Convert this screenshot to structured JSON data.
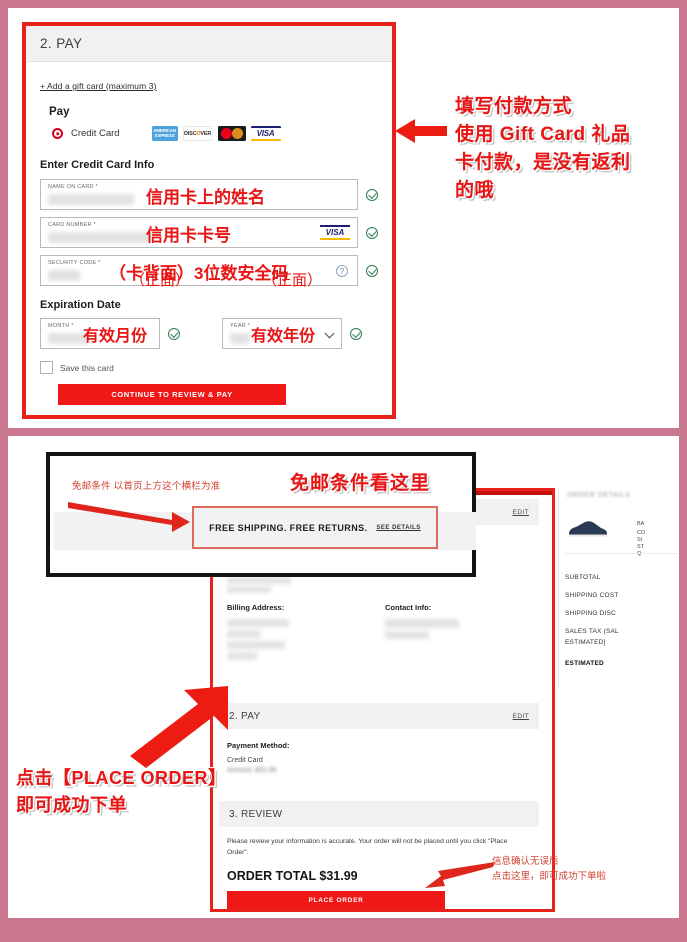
{
  "theme": {
    "outer_bg": "#c9788f",
    "accent_red": "#e8211b",
    "button_red": "#f01717",
    "annotation_red": "#e81515",
    "note_red": "#d0402f",
    "header_gray": "#f1f1f1"
  },
  "pay_card": {
    "header_title": "2. PAY",
    "gift_card_link": "+ Add a gift card (maximum 3)",
    "pay_label": "Pay",
    "method_label": "Credit Card",
    "card_logos": [
      {
        "name": "amex-logo",
        "text": "AMERICAN EXPRESS"
      },
      {
        "name": "discover-logo",
        "text": "DISCOVER"
      },
      {
        "name": "mastercard-logo",
        "text": ""
      },
      {
        "name": "visa-logo",
        "text": "VISA"
      }
    ],
    "enter_cc_title": "Enter Credit Card Info",
    "fields": [
      {
        "label": "NAME ON CARD *",
        "overlay": "信用卡上的姓名",
        "name": "name-on-card-field"
      },
      {
        "label": "CARD NUMBER *",
        "overlay": "信用卡卡号",
        "name": "card-number-field"
      },
      {
        "label": "SECURITY CODE *",
        "overlay": "（卡背面）3位数安全码",
        "name": "security-code-field"
      }
    ],
    "expiration_title": "Expiration Date",
    "month_label": "MONTH *",
    "year_label": "YEAR *",
    "month_overlay": "有效月份",
    "year_overlay": "有效年份",
    "month_side_note": "（正面）",
    "year_side_note": "（正面）",
    "save_card_label": "Save this card",
    "continue_button": "CONTINUE TO REVIEW & PAY",
    "visa_badge": "VISA",
    "help_icon": "?"
  },
  "annotation_top": {
    "lines": [
      "填写付款方式",
      "使用 Gift Card 礼品",
      "卡付款，是没有返利",
      "的哦"
    ],
    "arrow": "left-arrow-icon"
  },
  "shipping_callout": {
    "note": "免邮条件 以首页上方这个横栏为准",
    "highlight": "免邮条件看这里",
    "banner_text": "FREE SHIPPING. FREE RETURNS.",
    "see_details": "SEE DETAILS",
    "arrow": "right-arrow-icon"
  },
  "review_screen": {
    "ship_edit": "EDIT",
    "billing_address_label": "Billing Address:",
    "contact_info_label": "Contact Info:",
    "pay_section_title": "2. PAY",
    "pay_edit": "EDIT",
    "payment_method_label": "Payment Method:",
    "payment_method_value": "Credit Card",
    "payment_amount": "Amount: $31.99",
    "review_section_title": "3. REVIEW",
    "review_paragraph": "Please review your information is accurate. Your order will not be placed until you click \"Place Order\".",
    "order_total": "ORDER TOTAL $31.99",
    "place_order_button": "PLACE ORDER"
  },
  "order_details": {
    "header": "ORDER DETAILS",
    "item_icon": "sneaker-image",
    "item_attributes": [
      "BA",
      "CO",
      "SI",
      "ST",
      "Q"
    ],
    "rows": [
      "SUBTOTAL",
      "SHIPPING COST",
      "SHIPPING DISC",
      "SALES TAX (SAL",
      "ESTIMATED]",
      "ESTIMATED"
    ]
  },
  "annotation_bottom_left": {
    "lines": [
      "点击【PLACE ORDER】",
      "即可成功下单"
    ],
    "arrow": "up-right-arrow-icon"
  },
  "annotation_bottom_right": {
    "lines": [
      "信息确认无误后",
      "点击这里，即可成功下单啦"
    ],
    "arrow": "left-arrow-icon"
  }
}
